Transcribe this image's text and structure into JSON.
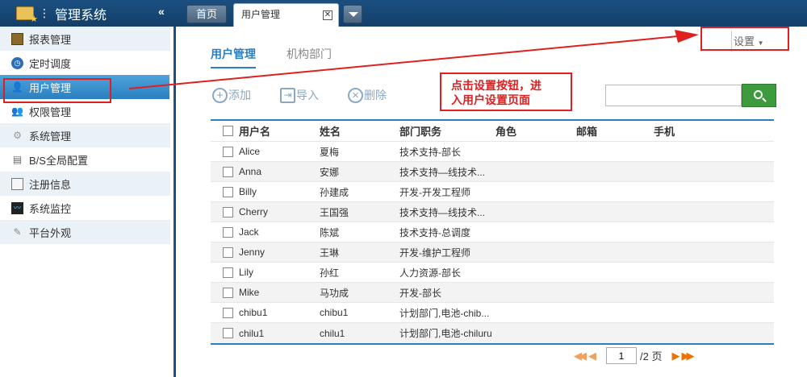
{
  "app": {
    "title": "管理系统"
  },
  "tabs": {
    "home": "首页",
    "active": "用户管理"
  },
  "sidebar": {
    "items": [
      {
        "label": "报表管理",
        "icon": "report-icon"
      },
      {
        "label": "定时调度",
        "icon": "clock-icon"
      },
      {
        "label": "用户管理",
        "icon": "user-icon",
        "active": true
      },
      {
        "label": "权限管理",
        "icon": "permission-icon"
      },
      {
        "label": "系统管理",
        "icon": "gear-icon"
      },
      {
        "label": "B/S全局配置",
        "icon": "server-icon"
      },
      {
        "label": "注册信息",
        "icon": "registration-icon"
      },
      {
        "label": "系统监控",
        "icon": "monitor-icon"
      },
      {
        "label": "平台外观",
        "icon": "appearance-icon"
      }
    ]
  },
  "header": {
    "settings_label": "设置"
  },
  "subtabs": [
    "用户管理",
    "机构部门"
  ],
  "toolbar": {
    "add": "添加",
    "import": "导入",
    "delete": "删除"
  },
  "callout": {
    "line1": "点击设置按钮，进",
    "line2": "入用户设置页面"
  },
  "search": {
    "placeholder": ""
  },
  "table": {
    "headers": [
      "用户名",
      "姓名",
      "部门职务",
      "角色",
      "邮箱",
      "手机"
    ],
    "rows": [
      {
        "username": "Alice",
        "name": "夏梅",
        "dept": "技术支持-部长",
        "role": "",
        "email": "",
        "phone": ""
      },
      {
        "username": "Anna",
        "name": "安娜",
        "dept": "技术支持—线技术...",
        "role": "",
        "email": "",
        "phone": ""
      },
      {
        "username": "Billy",
        "name": "孙建成",
        "dept": "开发-开发工程师",
        "role": "",
        "email": "",
        "phone": ""
      },
      {
        "username": "Cherry",
        "name": "王国强",
        "dept": "技术支持—线技术...",
        "role": "",
        "email": "",
        "phone": ""
      },
      {
        "username": "Jack",
        "name": "陈斌",
        "dept": "技术支持-总调度",
        "role": "",
        "email": "",
        "phone": ""
      },
      {
        "username": "Jenny",
        "name": "王琳",
        "dept": "开发-维护工程师",
        "role": "",
        "email": "",
        "phone": ""
      },
      {
        "username": "Lily",
        "name": "孙红",
        "dept": "人力资源-部长",
        "role": "",
        "email": "",
        "phone": ""
      },
      {
        "username": "Mike",
        "name": "马功成",
        "dept": "开发-部长",
        "role": "",
        "email": "",
        "phone": ""
      },
      {
        "username": "chibu1",
        "name": "chibu1",
        "dept": "计划部门,电池-chib...",
        "role": "",
        "email": "",
        "phone": ""
      },
      {
        "username": "chilu1",
        "name": "chilu1",
        "dept": "计划部门,电池-chiluru",
        "role": "",
        "email": "",
        "phone": ""
      }
    ]
  },
  "pager": {
    "current": "1",
    "total_text": "/2 页"
  },
  "colors": {
    "nav_bg": "#1b4f80",
    "accent": "#2a7fc0",
    "annotation": "#e02020",
    "search_btn": "#3d9a3d"
  }
}
